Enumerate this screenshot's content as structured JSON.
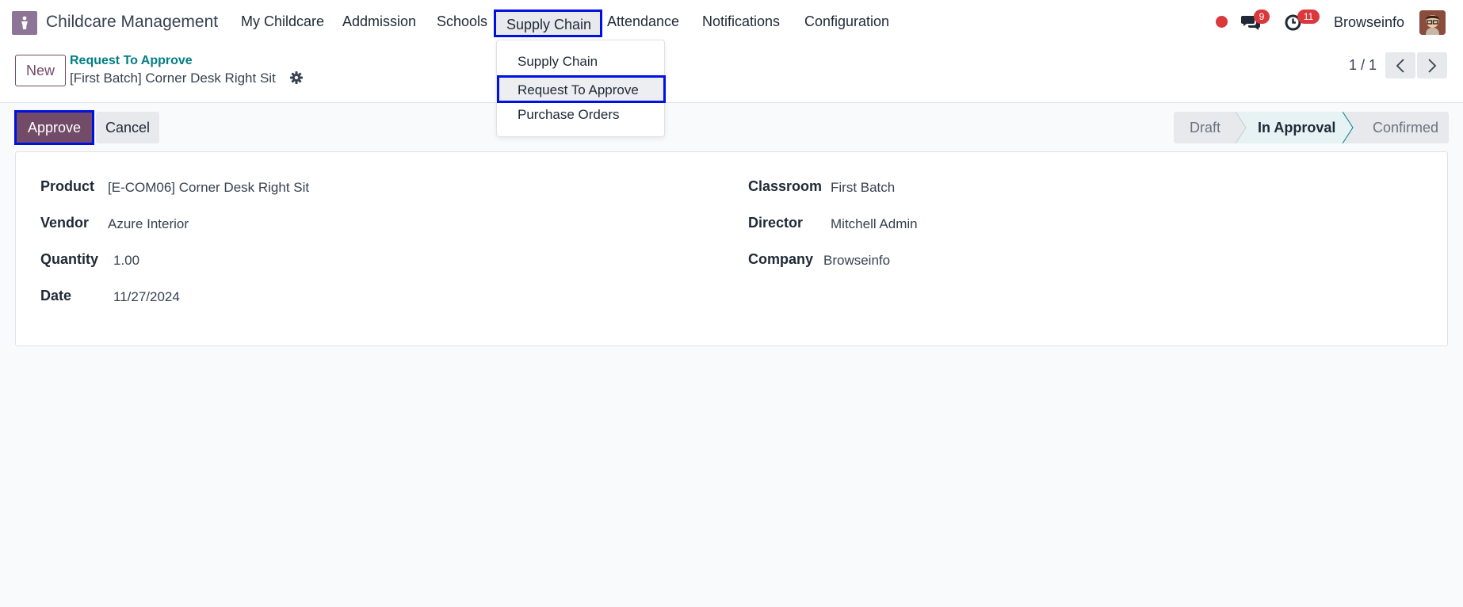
{
  "app": {
    "name": "Childcare Management",
    "logo_icon": "childcare-app-icon"
  },
  "nav": {
    "items": [
      "My Childcare",
      "Addmission",
      "Schools",
      "Supply Chain",
      "Attendance",
      "Notifications",
      "Configuration"
    ],
    "active": "Supply Chain"
  },
  "systray": {
    "messages_count": "9",
    "activities_count": "11",
    "company": "Browseinfo",
    "status_color": "#d9383d"
  },
  "dropdown": {
    "items": [
      "Supply Chain",
      "Request To Approve",
      "Purchase Orders"
    ],
    "active": "Request To Approve"
  },
  "control_panel": {
    "new_label": "New",
    "breadcrumb_parent": "Request To Approve",
    "breadcrumb_current": "[First Batch] Corner Desk Right Sit",
    "pager": "1 / 1"
  },
  "actions": {
    "approve_label": "Approve",
    "cancel_label": "Cancel"
  },
  "status": {
    "stages": [
      "Draft",
      "In Approval",
      "Confirmed"
    ],
    "current": "In Approval"
  },
  "form": {
    "left": [
      {
        "label": "Product",
        "value": "[E-COM06] Corner Desk Right Sit"
      },
      {
        "label": "Vendor",
        "value": "Azure Interior"
      },
      {
        "label": "Quantity",
        "value": "1.00"
      },
      {
        "label": "Date",
        "value": "11/27/2024"
      }
    ],
    "right": [
      {
        "label": "Classroom",
        "value": "First Batch"
      },
      {
        "label": "Director",
        "value": "Mitchell Admin"
      },
      {
        "label": "Company",
        "value": "Browseinfo"
      }
    ]
  },
  "colors": {
    "brand": "#714b67",
    "highlight_border": "#0010e0",
    "link": "#017e84",
    "badge": "#d9383d"
  }
}
